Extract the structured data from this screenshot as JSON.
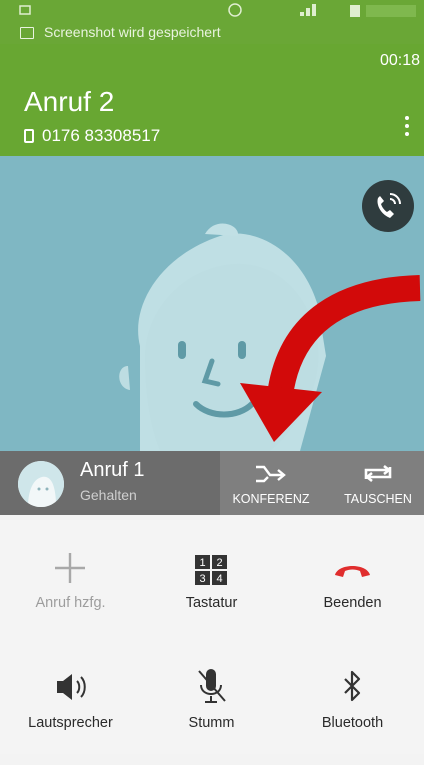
{
  "status_bar": {
    "notification": "Screenshot wird gespeichert"
  },
  "call": {
    "timer": "00:18",
    "title": "Anruf 2",
    "number": "0176 83308517"
  },
  "held_call": {
    "name": "Anruf 1",
    "status": "Gehalten"
  },
  "actions": {
    "merge": "KONFERENZ",
    "swap": "TAUSCHEN"
  },
  "buttons": {
    "add_call": "Anruf hzfg.",
    "keypad": "Tastatur",
    "end": "Beenden",
    "speaker": "Lautsprecher",
    "mute": "Stumm",
    "bluetooth": "Bluetooth"
  },
  "keypad_digits": [
    "1",
    "2",
    "3",
    "4"
  ],
  "colors": {
    "header_green": "#68a732",
    "end_call_red": "#e02d2d",
    "annotation_arrow": "#d20a0a"
  }
}
